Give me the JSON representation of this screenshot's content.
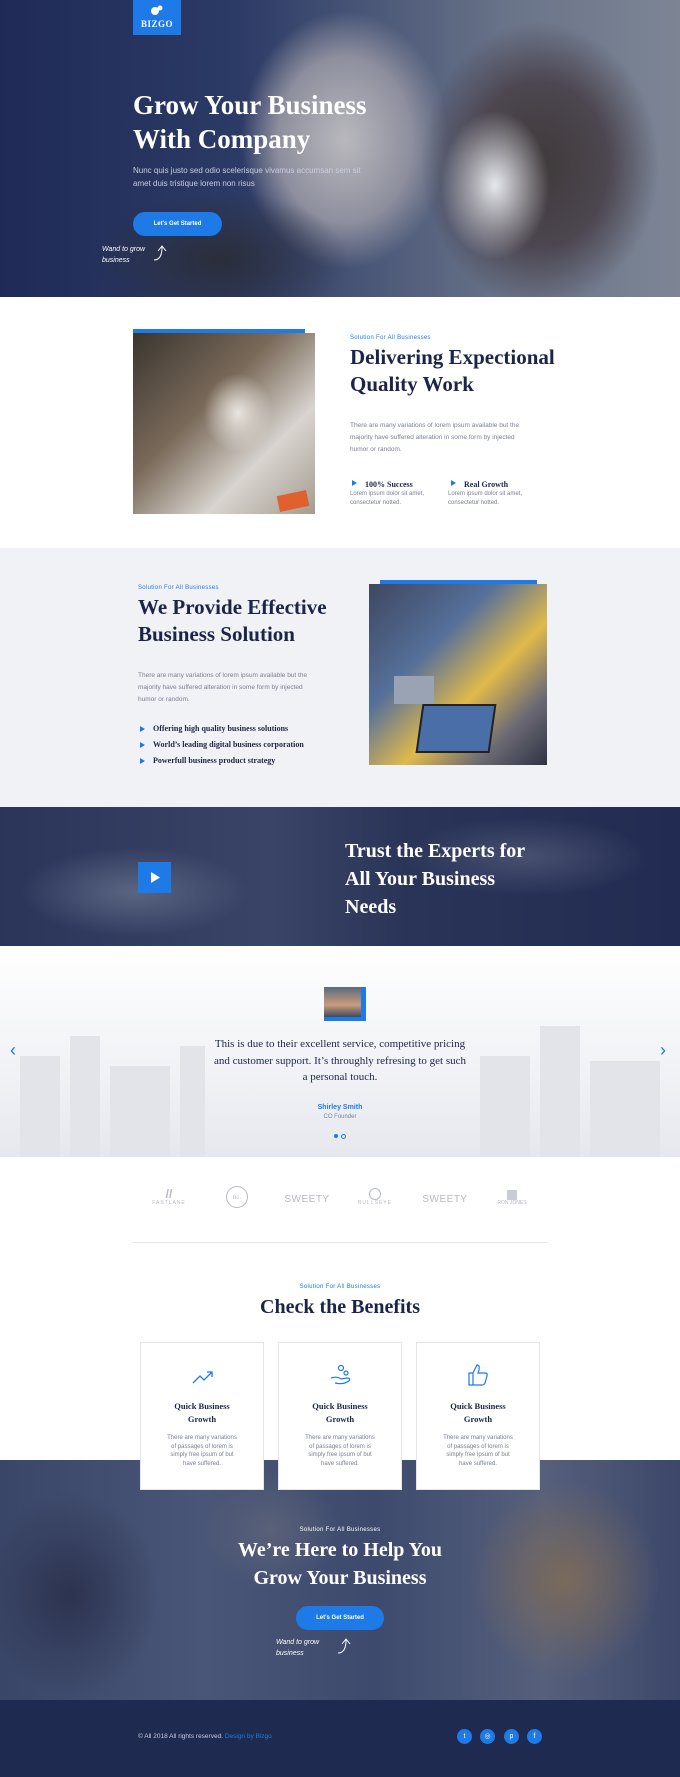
{
  "colors": {
    "accent": "#1e7ae6",
    "navy": "#1b2547",
    "footer": "#1e2a4f"
  },
  "hero": {
    "logo": "BIZGO",
    "title_line1": "Grow Your Business",
    "title_line2": "With Company",
    "subtitle_line1": "Nunc quis justo sed odio scelerisque vivamus accumsan sem sit",
    "subtitle_line2": "amet duis tristique lorem non risus",
    "cta": "Let's Get Started",
    "note_line1": "Wand to grow",
    "note_line2": "business"
  },
  "quality": {
    "eyebrow": "Solution For All Businesses",
    "title_line1": "Delivering Expectional",
    "title_line2": "Quality Work",
    "para_line1": "There are many variations of lorem ipsum available but the",
    "para_line2": "majority have suffered alteration in some form by injected",
    "para_line3": "humor or random.",
    "features": [
      {
        "title": "100% Success",
        "text_line1": "Lorem ipsum dolor sit amet,",
        "text_line2": "consectetur notted."
      },
      {
        "title": "Real Growth",
        "text_line1": "Lorem ipsum dolor sit amet,",
        "text_line2": "consectetur notted."
      }
    ]
  },
  "solution": {
    "eyebrow": "Solution For All Businesses",
    "title_line1": "We Provide Effective",
    "title_line2": "Business Solution",
    "para_line1": "There are many variations of lorem ipsum available but the",
    "para_line2": "majority have suffered alteration in some form by injected",
    "para_line3": "humor or random.",
    "items": [
      "Offering high quality business solutions",
      "World’s leading digital business corporation",
      "Powerfull business product strategy"
    ]
  },
  "video": {
    "title_line1": "Trust the Experts for",
    "title_line2": "All Your Business",
    "title_line3": "Needs",
    "play_icon": "play-icon"
  },
  "testimonial": {
    "quote_line1": "This is due to their excellent service, competitive pricing",
    "quote_line2": "and customer support. It’s throughly refresing to get such",
    "quote_line3": "a personal touch.",
    "name": "Shirley Smith",
    "role": "CO Founder"
  },
  "brands": [
    "FASTLANE",
    "nc.",
    "SWEETY",
    "BULLSEYE",
    "SWEETY",
    "RON JONES"
  ],
  "benefits": {
    "eyebrow": "Solution For All Businesses",
    "title": "Check the Benefits",
    "cards": [
      {
        "icon": "trend-up-icon",
        "title_line1": "Quick Business",
        "title_line2": "Growth",
        "text": [
          "There are many variations",
          "of passages of lorem is",
          "simply free ipsum of but",
          "have suffered."
        ]
      },
      {
        "icon": "hand-coins-icon",
        "title_line1": "Quick Business",
        "title_line2": "Growth",
        "text": [
          "There are many variations",
          "of passages of lorem is",
          "simply free ipsum of but",
          "have suffered."
        ]
      },
      {
        "icon": "thumbs-up-icon",
        "title_line1": "Quick Business",
        "title_line2": "Growth",
        "text": [
          "There are many variations",
          "of passages of lorem is",
          "simply free ipsum of but",
          "have suffered."
        ]
      }
    ]
  },
  "cta": {
    "eyebrow": "Solution For All Businesses",
    "title_line1": "We’re Here to Help You",
    "title_line2": "Grow Your Business",
    "button": "Let's Get Started",
    "note_line1": "Wand to grow",
    "note_line2": "business"
  },
  "footer": {
    "copyright": "© All 2018 All rights reserved.",
    "credit": "Design by Bizgo",
    "social": [
      "twitter-icon",
      "instagram-icon",
      "pinterest-icon",
      "facebook-icon"
    ]
  }
}
